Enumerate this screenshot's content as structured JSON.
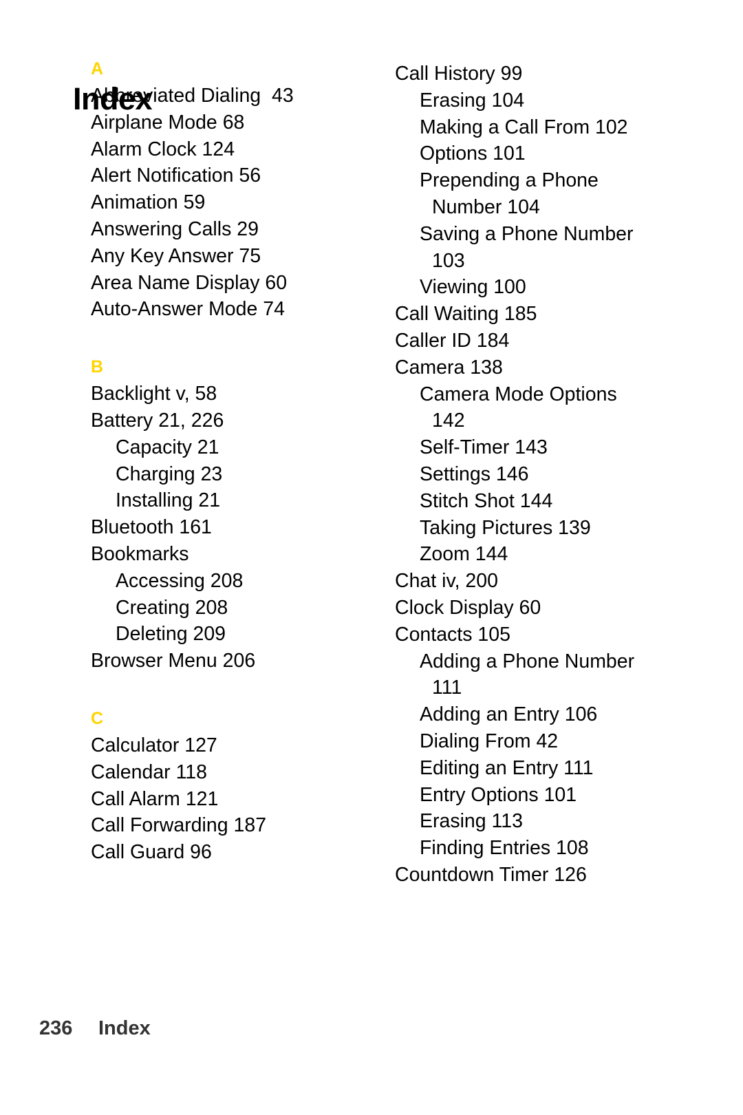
{
  "document": {
    "title": "Index",
    "footer": {
      "page_number": "236",
      "label": "Index"
    },
    "accent_color": "#FFD400",
    "text_color": "#000000"
  },
  "columns": {
    "left": [
      {
        "type": "letter",
        "text": "A"
      },
      {
        "type": "entry",
        "level": 0,
        "text": "Abbreviated Dialing  43"
      },
      {
        "type": "entry",
        "level": 0,
        "text": "Airplane Mode 68"
      },
      {
        "type": "entry",
        "level": 0,
        "text": "Alarm Clock 124"
      },
      {
        "type": "entry",
        "level": 0,
        "text": "Alert Notification 56"
      },
      {
        "type": "entry",
        "level": 0,
        "text": "Animation 59"
      },
      {
        "type": "entry",
        "level": 0,
        "text": "Answering Calls 29"
      },
      {
        "type": "entry",
        "level": 0,
        "text": "Any Key Answer 75"
      },
      {
        "type": "entry",
        "level": 0,
        "text": "Area Name Display 60"
      },
      {
        "type": "entry",
        "level": 0,
        "text": "Auto-Answer Mode 74"
      },
      {
        "type": "letter",
        "text": "B"
      },
      {
        "type": "entry",
        "level": 0,
        "text": "Backlight v, 58"
      },
      {
        "type": "entry",
        "level": 0,
        "text": "Battery 21, 226"
      },
      {
        "type": "entry",
        "level": 1,
        "text": "Capacity 21"
      },
      {
        "type": "entry",
        "level": 1,
        "text": "Charging 23"
      },
      {
        "type": "entry",
        "level": 1,
        "text": "Installing 21"
      },
      {
        "type": "entry",
        "level": 0,
        "text": "Bluetooth 161"
      },
      {
        "type": "entry",
        "level": 0,
        "text": "Bookmarks"
      },
      {
        "type": "entry",
        "level": 1,
        "text": "Accessing 208"
      },
      {
        "type": "entry",
        "level": 1,
        "text": "Creating 208"
      },
      {
        "type": "entry",
        "level": 1,
        "text": "Deleting 209"
      },
      {
        "type": "entry",
        "level": 0,
        "text": "Browser Menu 206"
      },
      {
        "type": "letter",
        "text": "C"
      },
      {
        "type": "entry",
        "level": 0,
        "text": "Calculator 127"
      },
      {
        "type": "entry",
        "level": 0,
        "text": "Calendar 118"
      },
      {
        "type": "entry",
        "level": 0,
        "text": "Call Alarm 121"
      },
      {
        "type": "entry",
        "level": 0,
        "text": "Call Forwarding 187"
      },
      {
        "type": "entry",
        "level": 0,
        "text": "Call Guard 96"
      }
    ],
    "right": [
      {
        "type": "entry",
        "level": 0,
        "text": "Call History 99"
      },
      {
        "type": "entry",
        "level": 1,
        "text": "Erasing 104"
      },
      {
        "type": "entry",
        "level": 1,
        "text": "Making a Call From 102"
      },
      {
        "type": "entry",
        "level": 1,
        "text": "Options 101"
      },
      {
        "type": "entry",
        "level": 1,
        "text": "Prepending a Phone"
      },
      {
        "type": "entry",
        "level": 1,
        "wrap": true,
        "text": "Number 104"
      },
      {
        "type": "entry",
        "level": 1,
        "text": "Saving a Phone Number"
      },
      {
        "type": "entry",
        "level": 1,
        "wrap": true,
        "text": "103"
      },
      {
        "type": "entry",
        "level": 1,
        "text": "Viewing 100"
      },
      {
        "type": "entry",
        "level": 0,
        "text": "Call Waiting 185"
      },
      {
        "type": "entry",
        "level": 0,
        "text": "Caller ID 184"
      },
      {
        "type": "entry",
        "level": 0,
        "text": "Camera 138"
      },
      {
        "type": "entry",
        "level": 1,
        "text": "Camera Mode Options"
      },
      {
        "type": "entry",
        "level": 1,
        "wrap": true,
        "text": "142"
      },
      {
        "type": "entry",
        "level": 1,
        "text": "Self-Timer 143"
      },
      {
        "type": "entry",
        "level": 1,
        "text": "Settings 146"
      },
      {
        "type": "entry",
        "level": 1,
        "text": "Stitch Shot 144"
      },
      {
        "type": "entry",
        "level": 1,
        "text": "Taking Pictures 139"
      },
      {
        "type": "entry",
        "level": 1,
        "text": "Zoom 144"
      },
      {
        "type": "entry",
        "level": 0,
        "text": "Chat iv, 200"
      },
      {
        "type": "entry",
        "level": 0,
        "text": "Clock Display 60"
      },
      {
        "type": "entry",
        "level": 0,
        "text": "Contacts 105"
      },
      {
        "type": "entry",
        "level": 1,
        "text": "Adding a Phone Number"
      },
      {
        "type": "entry",
        "level": 1,
        "wrap": true,
        "text": "111"
      },
      {
        "type": "entry",
        "level": 1,
        "text": "Adding an Entry 106"
      },
      {
        "type": "entry",
        "level": 1,
        "text": "Dialing From 42"
      },
      {
        "type": "entry",
        "level": 1,
        "text": "Editing an Entry 111"
      },
      {
        "type": "entry",
        "level": 1,
        "text": "Entry Options 101"
      },
      {
        "type": "entry",
        "level": 1,
        "text": "Erasing 113"
      },
      {
        "type": "entry",
        "level": 1,
        "text": "Finding Entries 108"
      },
      {
        "type": "entry",
        "level": 0,
        "text": "Countdown Timer 126"
      }
    ]
  }
}
